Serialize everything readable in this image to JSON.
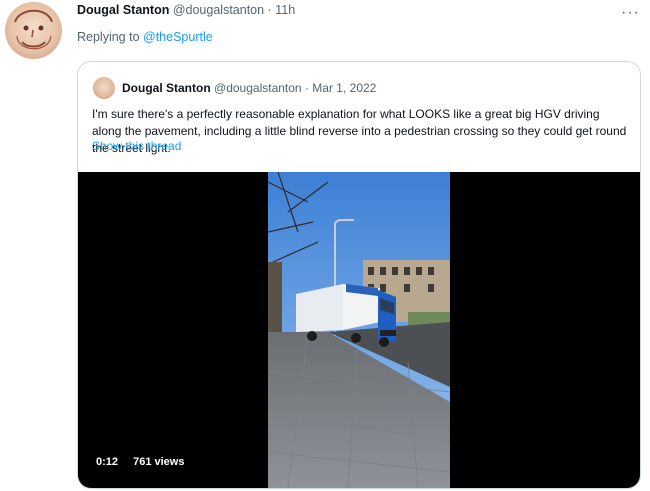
{
  "tweet": {
    "display_name": "Dougal Stanton",
    "handle": "@dougalstanton",
    "separator": "·",
    "time": "11h",
    "replying_prefix": "Replying to ",
    "replying_handle": "@theSpurtle",
    "more_glyph": "···"
  },
  "quoted": {
    "display_name": "Dougal Stanton",
    "handle": "@dougalstanton",
    "separator": "·",
    "date": "Mar 1, 2022",
    "text": "I'm sure there's a perfectly reasonable explanation for what LOOKS like a great big HGV driving along the pavement, including a little blind reverse into a pedestrian crossing so they could get round the street light.",
    "show_thread": "Show this thread",
    "video": {
      "timestamp": "0:12",
      "views": "761 views"
    }
  },
  "colors": {
    "accent": "#1d9bf0",
    "muted": "#536471",
    "border": "#cfd9de"
  }
}
